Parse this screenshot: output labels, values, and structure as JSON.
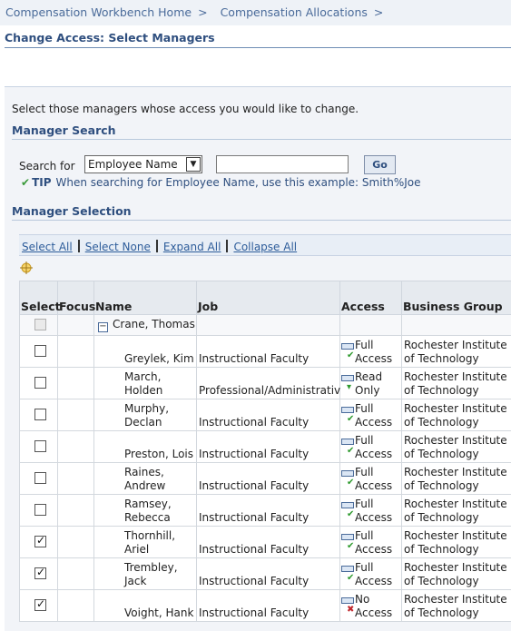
{
  "breadcrumb": {
    "items": [
      "Compensation Workbench Home",
      "Compensation Allocations"
    ],
    "separator": ">"
  },
  "page_title": "Change Access: Select Managers",
  "instructions": "Select those managers whose access you would like to change.",
  "manager_search": {
    "header": "Manager Search",
    "search_for_label": "Search for",
    "select_value": "Employee Name",
    "input_value": "",
    "go_label": "Go",
    "tip_label": "TIP",
    "tip_text": "When searching for Employee Name, use this example: Smith%Joe"
  },
  "manager_selection": {
    "header": "Manager Selection",
    "actions": [
      "Select All",
      "Select None",
      "Expand All",
      "Collapse All"
    ],
    "columns": [
      "Select",
      "Focus",
      "Name",
      "Job",
      "Access",
      "Business Group"
    ],
    "parent_row": {
      "name": "Crane, Thomas",
      "selectable": false
    },
    "rows": [
      {
        "name": [
          "",
          "Greylek, Kim"
        ],
        "job": "Instructional Faculty",
        "access": [
          "Full",
          "Access"
        ],
        "access_type": "full",
        "group": [
          "Rochester Institute",
          "of Technology"
        ],
        "checked": false
      },
      {
        "name": [
          "March,",
          "Holden"
        ],
        "job": "Professional/Administrative",
        "access": [
          "Read",
          "Only"
        ],
        "access_type": "read",
        "group": [
          "Rochester Institute",
          "of Technology"
        ],
        "checked": false
      },
      {
        "name": [
          "Murphy,",
          "Declan"
        ],
        "job": "Instructional Faculty",
        "access": [
          "Full",
          "Access"
        ],
        "access_type": "full",
        "group": [
          "Rochester Institute",
          "of Technology"
        ],
        "checked": false
      },
      {
        "name": [
          "",
          "Preston, Lois"
        ],
        "job": "Instructional Faculty",
        "access": [
          "Full",
          "Access"
        ],
        "access_type": "full",
        "group": [
          "Rochester Institute",
          "of Technology"
        ],
        "checked": false
      },
      {
        "name": [
          "Raines,",
          "Andrew"
        ],
        "job": "Instructional Faculty",
        "access": [
          "Full",
          "Access"
        ],
        "access_type": "full",
        "group": [
          "Rochester Institute",
          "of Technology"
        ],
        "checked": false
      },
      {
        "name": [
          "Ramsey,",
          "Rebecca"
        ],
        "job": "Instructional Faculty",
        "access": [
          "Full",
          "Access"
        ],
        "access_type": "full",
        "group": [
          "Rochester Institute",
          "of Technology"
        ],
        "checked": false
      },
      {
        "name": [
          "Thornhill,",
          "Ariel"
        ],
        "job": "Instructional Faculty",
        "access": [
          "Full",
          "Access"
        ],
        "access_type": "full",
        "group": [
          "Rochester Institute",
          "of Technology"
        ],
        "checked": true
      },
      {
        "name": [
          "Trembley,",
          "Jack"
        ],
        "job": "Instructional Faculty",
        "access": [
          "Full",
          "Access"
        ],
        "access_type": "full",
        "group": [
          "Rochester Institute",
          "of Technology"
        ],
        "checked": true
      },
      {
        "name": [
          "",
          "Voight, Hank"
        ],
        "job": "Instructional Faculty",
        "access": [
          "No",
          "Access"
        ],
        "access_type": "none",
        "group": [
          "Rochester Institute",
          "of Technology"
        ],
        "checked": true
      }
    ]
  }
}
